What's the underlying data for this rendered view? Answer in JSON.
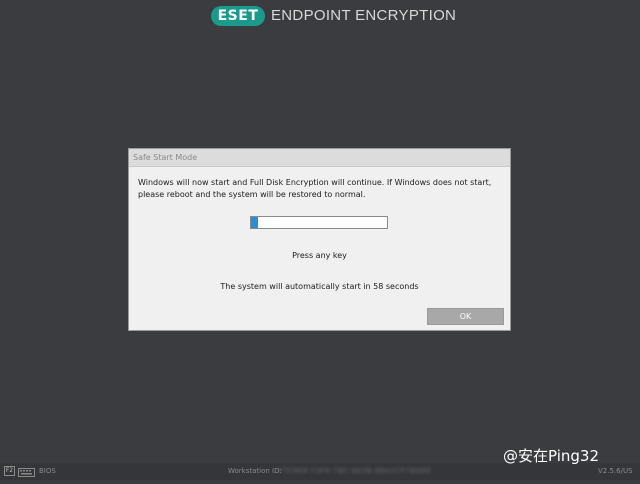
{
  "header": {
    "logo_text": "ESET",
    "product_title": "ENDPOINT ENCRYPTION"
  },
  "dialog": {
    "title": "Safe Start Mode",
    "message": "Windows will now start and Full Disk Encryption will continue. If Windows does not start, please reboot and the system will be restored to normal.",
    "progress_fraction": 0.05,
    "press_key_text": "Press any key",
    "countdown_text": "The system will automatically start in 58 seconds",
    "ok_label": "OK"
  },
  "statusbar": {
    "f2_key": "F2",
    "keyboard_icon": "keyboard-icon",
    "bios_label": "BIOS",
    "workstation_label": "Workstation ID:",
    "workstation_id": "F7C9E8-73F6-7BC-8E2B-8BA1CF7B9B8",
    "version": "V2.5.6/US"
  },
  "watermark": "@安在Ping32",
  "colors": {
    "background": "#3a3c40",
    "brand_teal": "#1a9a8a",
    "progress_blue": "#2b8fd6",
    "button_gray": "#a8a8a8"
  }
}
